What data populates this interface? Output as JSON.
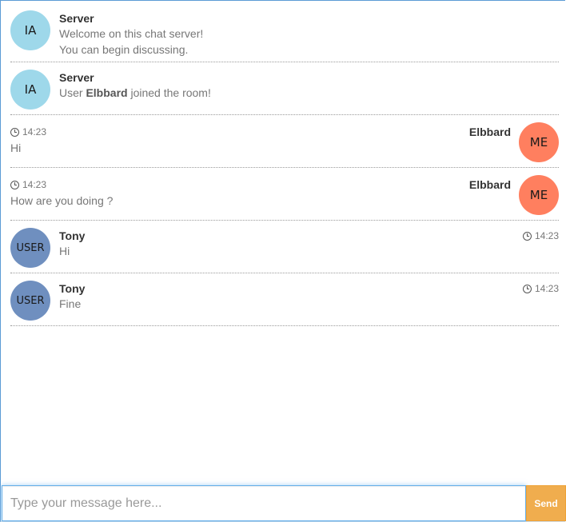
{
  "messages": [
    {
      "side": "left",
      "avatar": "IA",
      "avatar_color": "#9ed8ea",
      "name": "Server",
      "lines": [
        "Welcome on this chat server!",
        "You can begin discussing."
      ]
    },
    {
      "side": "left",
      "avatar": "IA",
      "avatar_color": "#9ed8ea",
      "name": "Server",
      "text_prefix": "User ",
      "text_bold": "Elbbard",
      "text_suffix": " joined the room!"
    },
    {
      "side": "right",
      "avatar": "ME",
      "avatar_color": "#ff7f5f",
      "name": "Elbbard",
      "time": "14:23",
      "text": "Hi"
    },
    {
      "side": "right",
      "avatar": "ME",
      "avatar_color": "#ff7f5f",
      "name": "Elbbard",
      "time": "14:23",
      "text": "How are you doing ?"
    },
    {
      "side": "left",
      "avatar": "USER",
      "avatar_color": "#6f8fbf",
      "name": "Tony",
      "time": "14:23",
      "text": "Hi"
    },
    {
      "side": "left",
      "avatar": "USER",
      "avatar_color": "#6f8fbf",
      "name": "Tony",
      "time": "14:23",
      "text": "Fine"
    }
  ],
  "composer": {
    "placeholder": "Type your message here...",
    "send_label": "Send"
  },
  "colors": {
    "send": "#f0ad4e",
    "focus_border": "#66afe9"
  },
  "icons": {
    "time": "clock-icon"
  }
}
